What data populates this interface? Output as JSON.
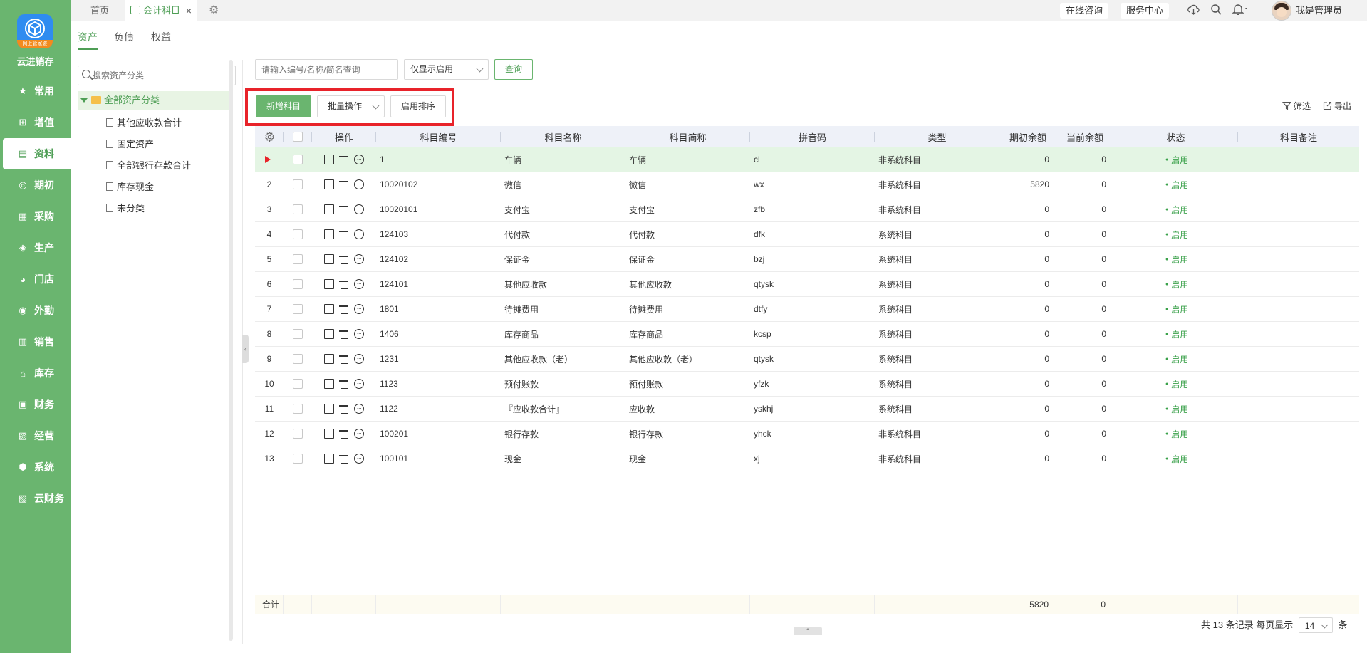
{
  "nav": {
    "logo_band": "网上管家婆",
    "brand": "云进销存",
    "items": [
      {
        "label": "常用",
        "icon": "star-icon",
        "glyph": "★"
      },
      {
        "label": "增值",
        "icon": "plus-square-icon",
        "glyph": "⊞"
      },
      {
        "label": "资料",
        "icon": "document-icon",
        "glyph": "▤"
      },
      {
        "label": "期初",
        "icon": "clock-icon",
        "glyph": "◎"
      },
      {
        "label": "采购",
        "icon": "cart-icon",
        "glyph": "▦"
      },
      {
        "label": "生产",
        "icon": "factory-icon",
        "glyph": "◈"
      },
      {
        "label": "门店",
        "icon": "pie-icon",
        "glyph": "◕"
      },
      {
        "label": "外勤",
        "icon": "location-icon",
        "glyph": "◉"
      },
      {
        "label": "销售",
        "icon": "chart-icon",
        "glyph": "▥"
      },
      {
        "label": "库存",
        "icon": "warehouse-icon",
        "glyph": "⌂"
      },
      {
        "label": "财务",
        "icon": "wallet-icon",
        "glyph": "▣"
      },
      {
        "label": "经营",
        "icon": "bar-chart-icon",
        "glyph": "▨"
      },
      {
        "label": "系统",
        "icon": "hexagon-icon",
        "glyph": "⬢"
      },
      {
        "label": "云财务",
        "icon": "cloud-finance-icon",
        "glyph": "▧"
      }
    ],
    "active_index": 2
  },
  "topbar": {
    "home_tab": "首页",
    "current_tab": "会计科目",
    "close": "×",
    "settings_glyph": "⚙",
    "online_consult": "在线咨询",
    "service_center": "服务中心",
    "username": "我是管理员"
  },
  "subtabs": [
    "资产",
    "负债",
    "权益"
  ],
  "tree": {
    "search_placeholder": "搜索资产分类",
    "root": "全部资产分类",
    "nodes": [
      "其他应收款合计",
      "固定资产",
      "全部银行存款合计",
      "库存现金",
      "未分类"
    ]
  },
  "filter": {
    "input_placeholder": "请输入编号/名称/简名查询",
    "select_value": "仅显示启用",
    "query_button": "查询"
  },
  "toolbar": {
    "add_button": "新增科目",
    "batch_button": "批量操作",
    "sort_button": "启用排序",
    "filter": "筛选",
    "export": "导出"
  },
  "table": {
    "headers": {
      "ops": "操作",
      "code": "科目编号",
      "name": "科目名称",
      "short": "科目简称",
      "pinyin": "拼音码",
      "type": "类型",
      "opening": "期初余额",
      "current": "当前余额",
      "status": "状态",
      "remark": "科目备注"
    },
    "rows": [
      {
        "no": "",
        "code": "1",
        "name": "车辆",
        "short": "车辆",
        "pinyin": "cl",
        "type": "非系统科目",
        "opening": "0",
        "current": "0",
        "status": "启用",
        "remark": ""
      },
      {
        "no": "2",
        "code": "10020102",
        "name": "微信",
        "short": "微信",
        "pinyin": "wx",
        "type": "非系统科目",
        "opening": "5820",
        "current": "0",
        "status": "启用",
        "remark": ""
      },
      {
        "no": "3",
        "code": "10020101",
        "name": "支付宝",
        "short": "支付宝",
        "pinyin": "zfb",
        "type": "非系统科目",
        "opening": "0",
        "current": "0",
        "status": "启用",
        "remark": ""
      },
      {
        "no": "4",
        "code": "124103",
        "name": "代付款",
        "short": "代付款",
        "pinyin": "dfk",
        "type": "系统科目",
        "opening": "0",
        "current": "0",
        "status": "启用",
        "remark": ""
      },
      {
        "no": "5",
        "code": "124102",
        "name": "保证金",
        "short": "保证金",
        "pinyin": "bzj",
        "type": "系统科目",
        "opening": "0",
        "current": "0",
        "status": "启用",
        "remark": ""
      },
      {
        "no": "6",
        "code": "124101",
        "name": "其他应收款",
        "short": "其他应收款",
        "pinyin": "qtysk",
        "type": "系统科目",
        "opening": "0",
        "current": "0",
        "status": "启用",
        "remark": ""
      },
      {
        "no": "7",
        "code": "1801",
        "name": "待摊费用",
        "short": "待摊费用",
        "pinyin": "dtfy",
        "type": "系统科目",
        "opening": "0",
        "current": "0",
        "status": "启用",
        "remark": ""
      },
      {
        "no": "8",
        "code": "1406",
        "name": "库存商品",
        "short": "库存商品",
        "pinyin": "kcsp",
        "type": "系统科目",
        "opening": "0",
        "current": "0",
        "status": "启用",
        "remark": ""
      },
      {
        "no": "9",
        "code": "1231",
        "name": "其他应收款（老）",
        "short": "其他应收款（老）",
        "pinyin": "qtysk",
        "type": "系统科目",
        "opening": "0",
        "current": "0",
        "status": "启用",
        "remark": ""
      },
      {
        "no": "10",
        "code": "1123",
        "name": "预付账款",
        "short": "预付账款",
        "pinyin": "yfzk",
        "type": "系统科目",
        "opening": "0",
        "current": "0",
        "status": "启用",
        "remark": ""
      },
      {
        "no": "11",
        "code": "1122",
        "name": "『应收款合计』",
        "short": "应收款",
        "pinyin": "yskhj",
        "type": "系统科目",
        "opening": "0",
        "current": "0",
        "status": "启用",
        "remark": ""
      },
      {
        "no": "12",
        "code": "100201",
        "name": "银行存款",
        "short": "银行存款",
        "pinyin": "yhck",
        "type": "非系统科目",
        "opening": "0",
        "current": "0",
        "status": "启用",
        "remark": ""
      },
      {
        "no": "13",
        "code": "100101",
        "name": "现金",
        "short": "现金",
        "pinyin": "xj",
        "type": "非系统科目",
        "opening": "0",
        "current": "0",
        "status": "启用",
        "remark": ""
      }
    ],
    "total_label": "合计",
    "total_opening": "5820",
    "total_current": "0"
  },
  "footer": {
    "summary": "共 13 条记录 每页显示",
    "page_size": "14",
    "unit": "条"
  },
  "colors": {
    "nav_bg": "#6ab56f",
    "accent": "#4e9e55",
    "highlight": "#e8232a"
  }
}
